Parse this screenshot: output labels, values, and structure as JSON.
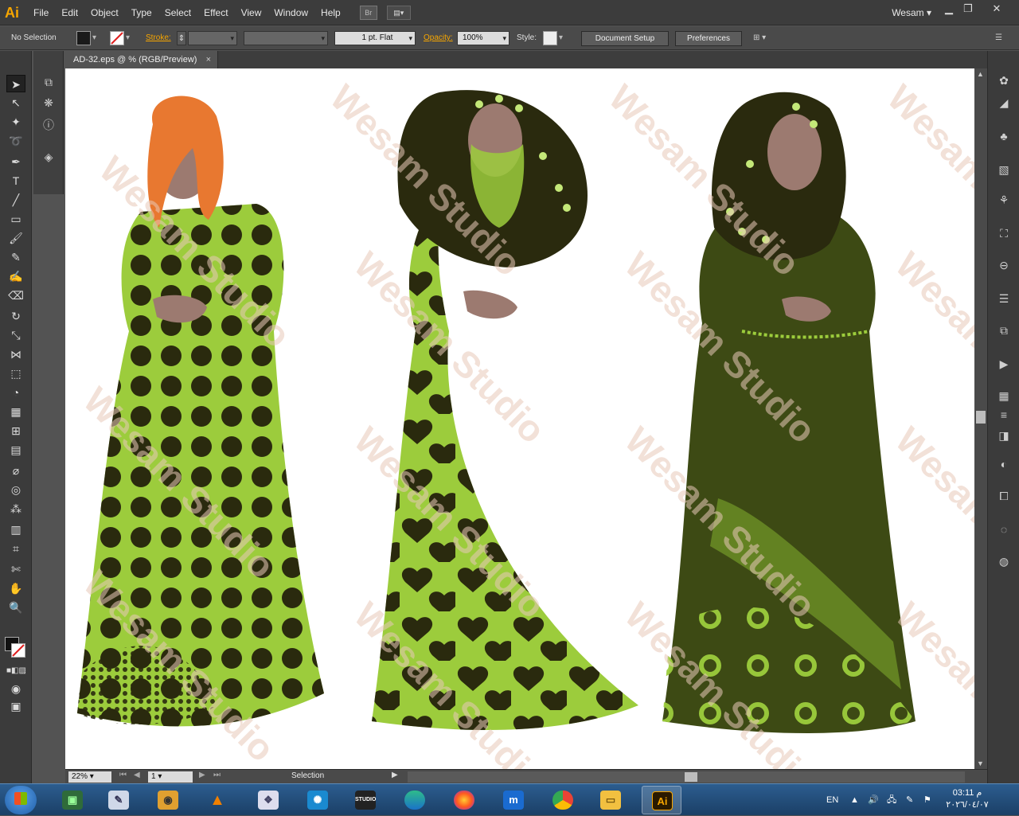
{
  "app": {
    "logo": "Ai",
    "user": "Wesam",
    "bridge_label": "Br",
    "arrange_label": "▤▾"
  },
  "menu": [
    "File",
    "Edit",
    "Object",
    "Type",
    "Select",
    "Effect",
    "View",
    "Window",
    "Help"
  ],
  "control": {
    "selection_state": "No Selection",
    "stroke_label": "Stroke:",
    "brush_value": "1 pt. Flat",
    "opacity_label": "Opacity:",
    "opacity_value": "100%",
    "style_label": "Style:",
    "document_setup": "Document Setup",
    "preferences": "Preferences"
  },
  "document": {
    "tab_title": "AD-32.eps @ % (RGB/Preview)",
    "close": "×"
  },
  "status": {
    "zoom": "22%",
    "page": "1",
    "tool": "Selection"
  },
  "artwork": {
    "watermark": "Wesam Studio",
    "colors": {
      "lime": "#9ccc3c",
      "dark": "#2a2a0e",
      "olive": "#3d4a14",
      "hair_orange": "#e87830",
      "skin": "#9c7a70"
    }
  },
  "taskbar": {
    "lang": "EN",
    "time": "03:11 م",
    "date": "٢٠٢٦/٠٤/٠٧",
    "studio_label": "STUDIO",
    "ai_label": "Ai"
  }
}
